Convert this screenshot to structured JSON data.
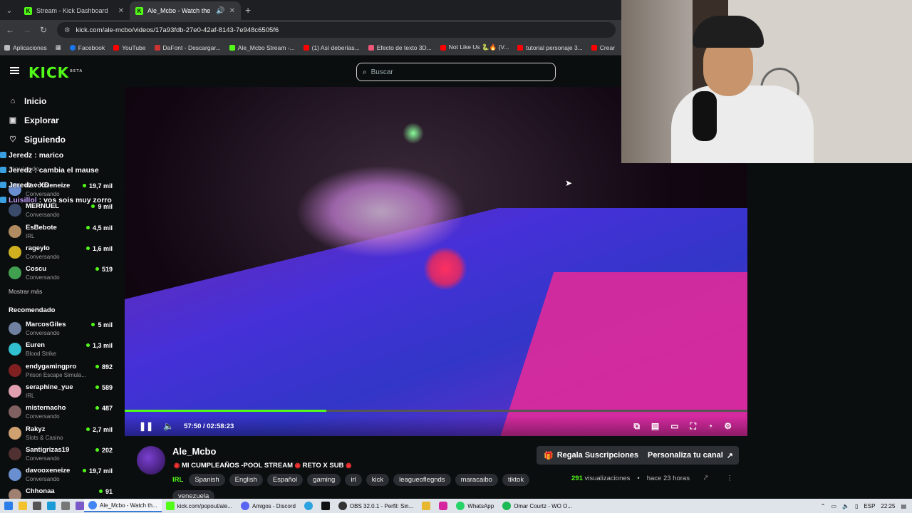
{
  "browser": {
    "tabs": [
      {
        "title": "Stream - Kick Dashboard"
      },
      {
        "title": "Ale_Mcbo - Watch the VOD"
      }
    ],
    "url": "kick.com/ale-mcbo/videos/17a93fdb-27e0-42af-8143-7e948c6505f6",
    "bookmarks": [
      "Aplicaciones",
      "Facebook",
      "YouTube",
      "DaFont - Descargar...",
      "Ale_Mcbo Stream -...",
      "(1) Así deberías...",
      "Efecto de texto 3D...",
      "Not Like Us 🐍🔥 (V...",
      "tutorial personaje 3...",
      "Crear"
    ]
  },
  "kick": {
    "logo": "KICK",
    "logo_beta": "BETA",
    "search_placeholder": "Buscar",
    "nav": [
      "Inicio",
      "Explorar",
      "Siguiendo"
    ],
    "following_label": "Siguiendo",
    "following": [
      {
        "name": "davooxeneize",
        "game": "Conversando",
        "viewers": "19,7 mil",
        "color": "#6a8fd0"
      },
      {
        "name": "MERNUEL",
        "game": "Conversando",
        "viewers": "9 mil",
        "color": "#3a4a6a"
      },
      {
        "name": "EsBebote",
        "game": "IRL",
        "viewers": "4,5 mil",
        "color": "#b08a60"
      },
      {
        "name": "rageylo",
        "game": "Conversando",
        "viewers": "1,6 mil",
        "color": "#d0b020"
      },
      {
        "name": "Coscu",
        "game": "Conversando",
        "viewers": "519",
        "color": "#40a050"
      }
    ],
    "show_more": "Mostrar más",
    "recommended_label": "Recomendado",
    "recommended": [
      {
        "name": "MarcosGiles",
        "game": "Conversando",
        "viewers": "5 mil",
        "color": "#7080a0"
      },
      {
        "name": "Euren",
        "game": "Blood Strike",
        "viewers": "1,3 mil",
        "color": "#30c0d0"
      },
      {
        "name": "endygamingpro",
        "game": "Prison Escape Simula...",
        "viewers": "892",
        "color": "#802020"
      },
      {
        "name": "seraphine_yue",
        "game": "IRL",
        "viewers": "589",
        "color": "#e0a0b0"
      },
      {
        "name": "misternacho",
        "game": "Conversando",
        "viewers": "487",
        "color": "#806060"
      },
      {
        "name": "Rakyz",
        "game": "Slots & Casino",
        "viewers": "2,7 mil",
        "color": "#d0a070"
      },
      {
        "name": "Santigrizas19",
        "game": "Conversando",
        "viewers": "202",
        "color": "#503030"
      },
      {
        "name": "davooxeneize",
        "game": "Conversando",
        "viewers": "19,7 mil",
        "color": "#6a8fd0"
      },
      {
        "name": "Chhonaa",
        "game": "",
        "viewers": "91",
        "color": "#a08070"
      }
    ]
  },
  "chat_overlay": [
    {
      "user": "Jeredz",
      "msg": ": marico"
    },
    {
      "user": "Jeredz",
      "msg": ": cambia el mause"
    },
    {
      "user": "Jeredz",
      "msg": ": XD"
    },
    {
      "user": "Luisillol",
      "msg": ": vos sois muy zorro"
    }
  ],
  "player": {
    "time": "57:50 / 02:58:23",
    "progress": 0.324
  },
  "video_info": {
    "channel": "Ale_Mcbo",
    "title": "MI CUMPLEAÑOS -POOL STREAM",
    "title_suffix": "RETO X SUB",
    "category": "IRL",
    "tags": [
      "Spanish",
      "English",
      "Español",
      "gaming",
      "irl",
      "kick",
      "leagueoflegnds",
      "maracaibo",
      "tiktok",
      "venezuela"
    ],
    "gift_button": "Regala Suscripciones",
    "customize_button": "Personaliza tu canal",
    "views_count": "291",
    "views_label": "visualizaciones",
    "time_ago": "hace 23 horas"
  },
  "taskbar": {
    "apps": [
      "Ale_Mcbo - Watch th...",
      "kick.com/popout/ale...",
      "Amigos - Discord",
      "OBS 32.0.1 - Perfil: Sin...",
      "WhatsApp",
      "Omar Courtz - WO O..."
    ],
    "lang": "ESP",
    "clock": "22:25"
  }
}
